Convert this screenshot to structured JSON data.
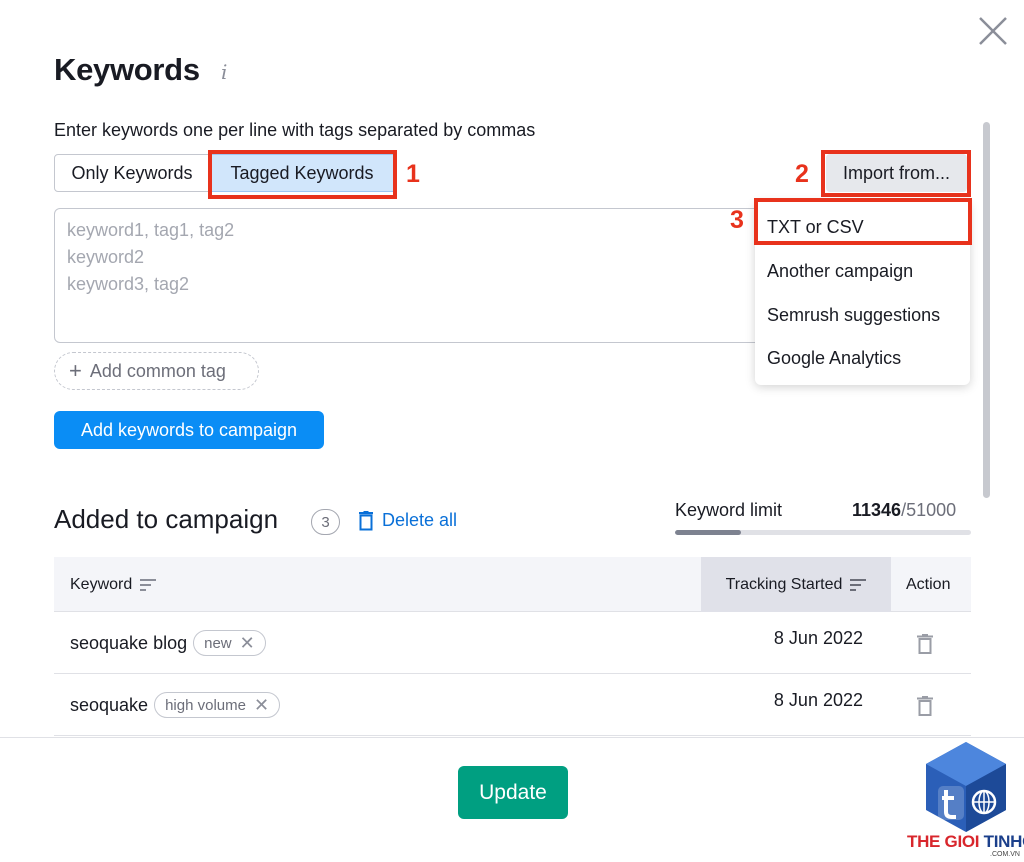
{
  "modal": {
    "title": "Keywords",
    "info_glyph": "i",
    "close_icon": "close-icon",
    "instructions": "Enter keywords one per line with tags separated by commas"
  },
  "input_mode": {
    "options": [
      "Only Keywords",
      "Tagged Keywords"
    ],
    "selected": "Tagged Keywords"
  },
  "import": {
    "button_label": "Import from...",
    "menu_items": [
      "TXT or CSV",
      "Another campaign",
      "Semrush suggestions",
      "Google Analytics"
    ]
  },
  "annotations": {
    "step1": "1",
    "step2": "2",
    "step3": "3",
    "color": "#e8321c"
  },
  "keyword_input": {
    "placeholder": "keyword1, tag1, tag2\nkeyword2\nkeyword3, tag2"
  },
  "add_tag": {
    "plus": "+",
    "label": "Add common tag"
  },
  "add_button": {
    "label": "Add keywords to campaign"
  },
  "added": {
    "title": "Added to campaign",
    "count": "3",
    "delete_all": "Delete all",
    "limit_label": "Keyword limit",
    "limit_used": "11346",
    "limit_total": "/51000",
    "limit_fraction": 0.222
  },
  "table": {
    "columns": [
      "Keyword",
      "Tracking Started",
      "Action"
    ],
    "rows": [
      {
        "keyword": "seoquake blog",
        "tag": "new",
        "date": "8 Jun 2022"
      },
      {
        "keyword": "seoquake",
        "tag": "high volume",
        "date": "8 Jun 2022"
      }
    ],
    "remove_glyph": "✕"
  },
  "footer": {
    "update_label": "Update"
  },
  "colors": {
    "primary": "#0a8df5",
    "success": "#009f81",
    "selected_bg": "#d1e6fb"
  },
  "logo": {
    "part1": "THE GIOI ",
    "part2": "TINHOC",
    "sub": ".COM.VN"
  }
}
